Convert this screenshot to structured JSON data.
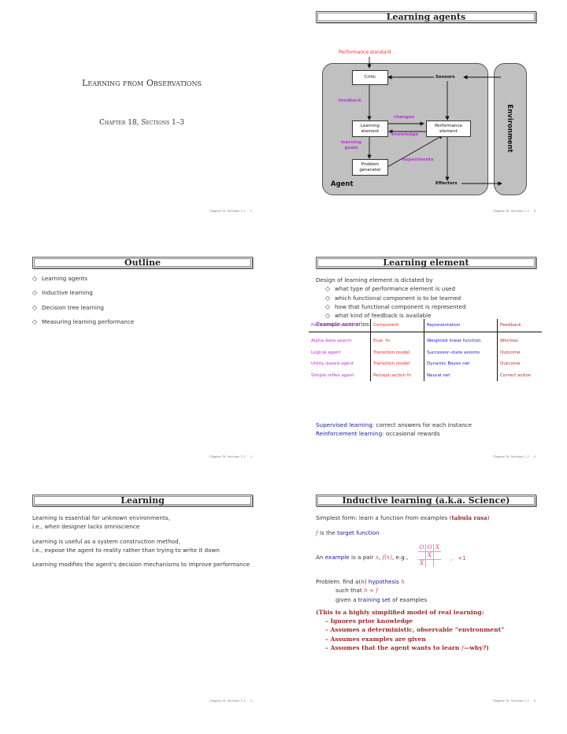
{
  "footer_text": "Chapter 18, Sections 1–3",
  "slides": {
    "s1": {
      "page": "1",
      "title": "Learning from Observations",
      "subtitle": "Chapter 18, Sections 1–3"
    },
    "s2": {
      "page": "2",
      "title": "Outline",
      "bullets": [
        "Learning agents",
        "Inductive learning",
        "Decision tree learning",
        "Measuring learning performance"
      ]
    },
    "s3": {
      "page": "3",
      "title": "Learning",
      "paragraphs": [
        [
          "Learning is essential for unknown environments,",
          "i.e., when designer lacks omniscience"
        ],
        [
          "Learning is useful as a system construction method,",
          "i.e., expose the agent to reality rather than trying to write it down"
        ],
        [
          "Learning modifies the agent's decision mechanisms to improve performance"
        ]
      ]
    },
    "s4": {
      "page": "4",
      "title": "Learning agents",
      "diagram": {
        "performance_standard": "Performance standard",
        "critic": "Critic",
        "sensors": "Sensors",
        "feedback": "feedback",
        "changes": "changes",
        "learning_element_1": "Learning",
        "learning_element_2": "element",
        "performance_element_1": "Performance",
        "performance_element_2": "element",
        "knowledge": "knowledge",
        "learning_goals_1": "learning",
        "learning_goals_2": "goals",
        "experiments": "experiments",
        "problem_generator_1": "Problem",
        "problem_generator_2": "generator",
        "agent": "Agent",
        "effectors": "Effectors",
        "environment": "Environment"
      }
    },
    "s5": {
      "page": "5",
      "title": "Learning element",
      "intro": "Design of learning element is dictated by",
      "bullets": [
        "what type of performance element is used",
        "which functional component is to be learned",
        "how that functional component is represented",
        "what kind of feedback is available"
      ],
      "scenarios_label": "Example scenarios:",
      "table": {
        "headers": [
          "Performance element",
          "Component",
          "Representation",
          "Feedback"
        ],
        "rows": [
          [
            "Alpha–beta search",
            "Eval. fn.",
            "Weighted linear function",
            "Win/loss"
          ],
          [
            "Logical agent",
            "Transition model",
            "Successor–state axioms",
            "Outcome"
          ],
          [
            "Utility–based agent",
            "Transition model",
            "Dynamic Bayes net",
            "Outcome"
          ],
          [
            "Simple reflex agent",
            "Percept–action fn",
            "Neural net",
            "Correct action"
          ]
        ]
      },
      "supervised_term": "Supervised learning",
      "supervised_desc": ": correct answers for each instance",
      "reinforcement_term": "Reinforcement learning",
      "reinforcement_desc": ": occasional rewards"
    },
    "s6": {
      "page": "6",
      "title": "Inductive learning (a.k.a. Science)",
      "line1_pre": "Simplest form: learn a function from examples (",
      "line1_bold": "tabula rasa",
      "line1_post": ")",
      "line2_f": "f",
      "line2_mid": " is the ",
      "line2_term": "target function",
      "line3_pre": "An ",
      "line3_term": "example",
      "line3_mid": " is a pair ",
      "line3_x": "x",
      "line3_comma": ", ",
      "line3_fx": "f(x)",
      "line3_eg": ", e.g., ",
      "board": [
        [
          "O",
          "O",
          "X"
        ],
        [
          "",
          "X",
          ""
        ],
        [
          "X",
          "",
          ""
        ]
      ],
      "board_value": ",   +1",
      "problem_pre": "Problem: find a(n) ",
      "problem_term": "hypothesis",
      "problem_h": " h",
      "such_that_pre": "such that ",
      "such_that_math": "h ≈ f",
      "given_pre": "given a ",
      "given_term": "training set",
      "given_post": " of examples",
      "caveat_title": "(This is a highly simplified model of real learning:",
      "caveats": [
        "– Ignores prior knowledge",
        "– Assumes a deterministic, observable “environment”",
        "– Assumes examples are given"
      ],
      "last_caveat_pre": "– Assumes that the agent wants to learn ",
      "last_caveat_f": "f",
      "last_caveat_post": "—why?)"
    }
  }
}
